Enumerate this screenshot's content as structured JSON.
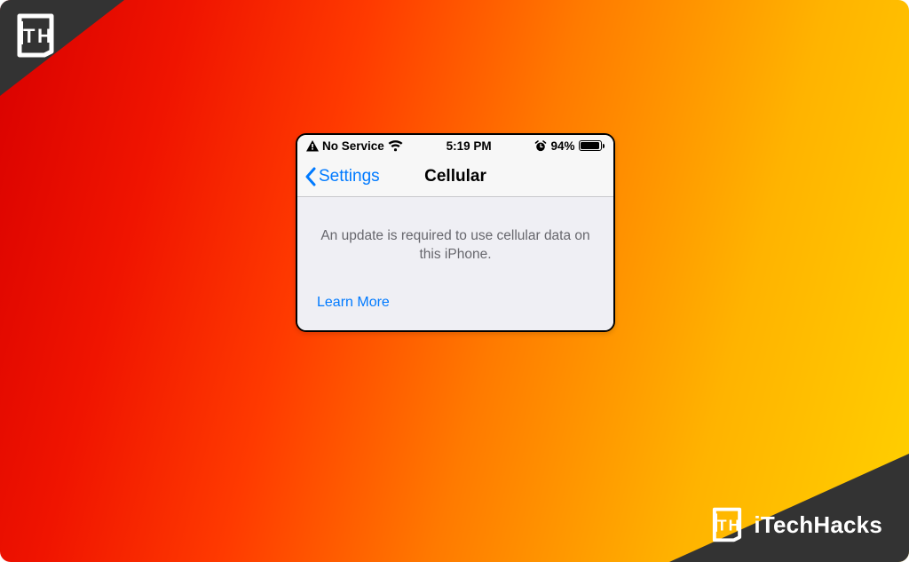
{
  "brand": {
    "name": "iTechHacks"
  },
  "statusbar": {
    "service": "No Service",
    "time": "5:19 PM",
    "battery_percent": "94%"
  },
  "nav": {
    "back_label": "Settings",
    "title": "Cellular"
  },
  "body": {
    "message": "An update is required to use cellular data on this iPhone.",
    "learn_more": "Learn More"
  }
}
